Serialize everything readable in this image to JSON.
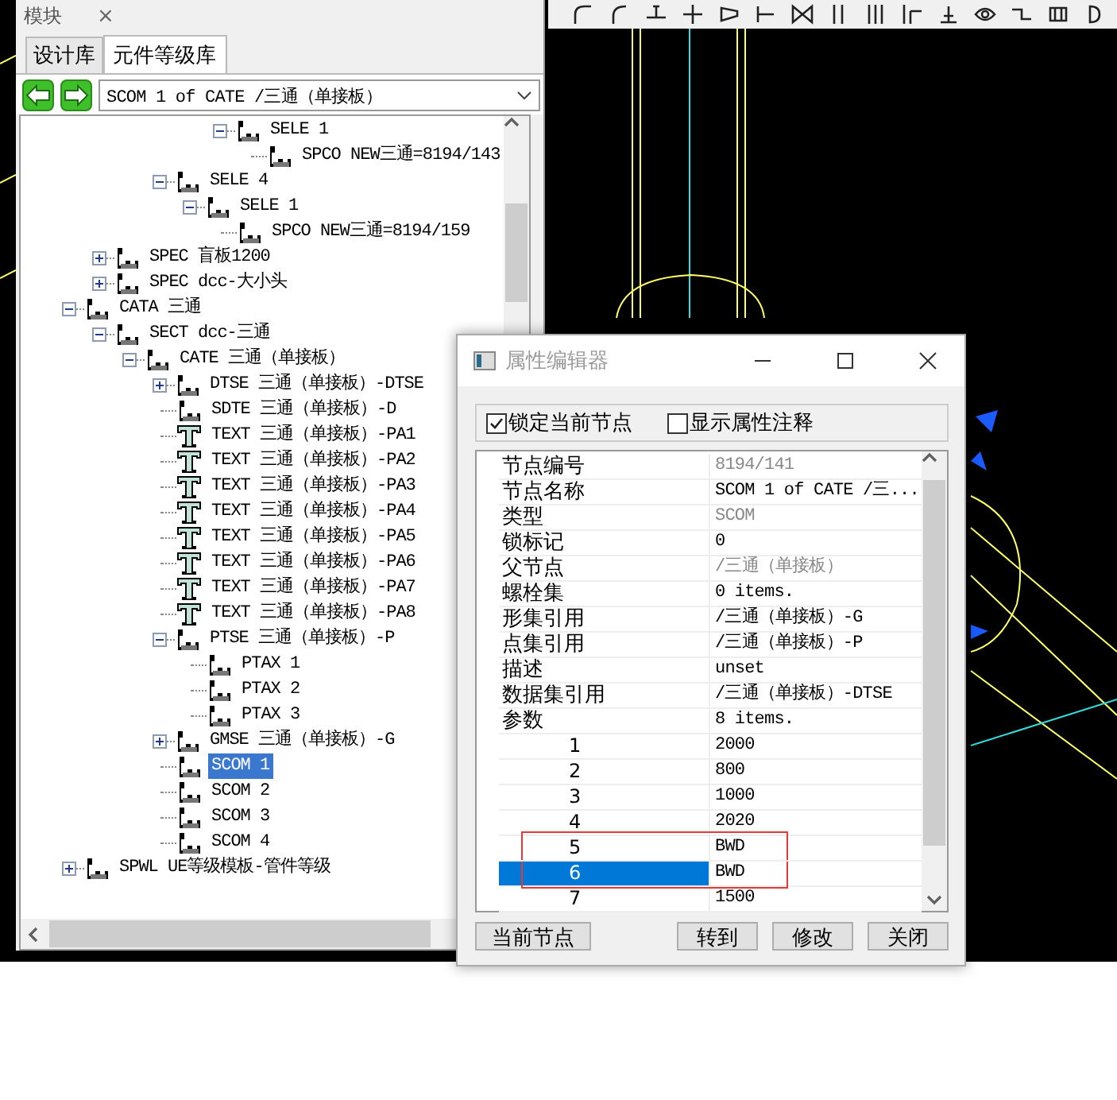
{
  "left_panel": {
    "title": "模块",
    "close": "×",
    "tabs": [
      {
        "label": "设计库",
        "selected": false
      },
      {
        "label": "元件等级库",
        "selected": true
      }
    ],
    "address": "SCOM 1 of CATE /三通（单接板）",
    "tree": [
      {
        "children": [
          {
            "children": [
              {
                "children": [
                  {
                    "children": [
                      {
                        "children": [
                          {
                            "label": "SELE 1",
                            "kind": "component",
                            "expanded": true,
                            "selected": false,
                            "children": [
                              {
                                "label": "SPCO NEW三通=8194/143",
                                "kind": "component",
                                "selected": false
                              }
                            ]
                          }
                        ]
                      }
                    ]
                  },
                  {
                    "label": "SELE 4",
                    "kind": "component",
                    "expanded": true,
                    "selected": false,
                    "children": [
                      {
                        "label": "SELE 1",
                        "kind": "component",
                        "expanded": true,
                        "selected": false,
                        "children": [
                          {
                            "label": "SPCO NEW三通=8194/159",
                            "kind": "component",
                            "selected": false
                          }
                        ]
                      }
                    ]
                  }
                ]
              }
            ]
          },
          {
            "label": "SPEC 盲板1200",
            "kind": "component",
            "expanded": false,
            "selected": false
          },
          {
            "label": "SPEC dcc-大小头",
            "kind": "component",
            "expanded": false,
            "selected": false
          }
        ]
      },
      {
        "label": "CATA 三通",
        "kind": "component",
        "expanded": true,
        "selected": false,
        "children": [
          {
            "label": "SECT dcc-三通",
            "kind": "component",
            "expanded": true,
            "selected": false,
            "children": [
              {
                "label": "CATE 三通（单接板）",
                "kind": "component",
                "expanded": true,
                "selected": false,
                "children": [
                  {
                    "label": "DTSE 三通（单接板）-DTSE",
                    "kind": "component",
                    "expanded": false,
                    "selected": false
                  },
                  {
                    "label": "SDTE 三通（单接板）-D",
                    "kind": "component",
                    "selected": false
                  },
                  {
                    "label": "TEXT 三通（单接板）-PA1",
                    "kind": "text",
                    "selected": false
                  },
                  {
                    "label": "TEXT 三通（单接板）-PA2",
                    "kind": "text",
                    "selected": false
                  },
                  {
                    "label": "TEXT 三通（单接板）-PA3",
                    "kind": "text",
                    "selected": false
                  },
                  {
                    "label": "TEXT 三通（单接板）-PA4",
                    "kind": "text",
                    "selected": false
                  },
                  {
                    "label": "TEXT 三通（单接板）-PA5",
                    "kind": "text",
                    "selected": false
                  },
                  {
                    "label": "TEXT 三通（单接板）-PA6",
                    "kind": "text",
                    "selected": false
                  },
                  {
                    "label": "TEXT 三通（单接板）-PA7",
                    "kind": "text",
                    "selected": false
                  },
                  {
                    "label": "TEXT 三通（单接板）-PA8",
                    "kind": "text",
                    "selected": false
                  },
                  {
                    "label": "PTSE 三通（单接板）-P",
                    "kind": "component",
                    "expanded": true,
                    "selected": false,
                    "children": [
                      {
                        "label": "PTAX 1",
                        "kind": "component",
                        "selected": false
                      },
                      {
                        "label": "PTAX 2",
                        "kind": "component",
                        "selected": false
                      },
                      {
                        "label": "PTAX 3",
                        "kind": "component",
                        "selected": false
                      }
                    ]
                  },
                  {
                    "label": "GMSE 三通（单接板）-G",
                    "kind": "component",
                    "expanded": false,
                    "selected": false
                  },
                  {
                    "label": "SCOM 1",
                    "kind": "component",
                    "selected": true
                  },
                  {
                    "label": "SCOM 2",
                    "kind": "component",
                    "selected": false
                  },
                  {
                    "label": "SCOM 3",
                    "kind": "component",
                    "selected": false
                  },
                  {
                    "label": "SCOM 4",
                    "kind": "component",
                    "selected": false
                  }
                ]
              }
            ]
          }
        ]
      },
      {
        "label": "SPWL UE等级模板-管件等级",
        "kind": "component",
        "expanded": false,
        "selected": false
      }
    ]
  },
  "dialog": {
    "title": "属性编辑器",
    "options": [
      {
        "label": "锁定当前节点",
        "checked": true
      },
      {
        "label": "显示属性注释",
        "checked": false
      }
    ],
    "properties": [
      {
        "name": "节点编号",
        "value": "8194/141",
        "dimmed": true
      },
      {
        "name": "节点名称",
        "value": "SCOM 1 of CATE /三...",
        "dimmed": false
      },
      {
        "name": "类型",
        "value": "SCOM",
        "dimmed": true
      },
      {
        "name": "锁标记",
        "value": "0",
        "dimmed": false
      },
      {
        "name": "父节点",
        "value": "/三通（单接板）",
        "dimmed": true
      },
      {
        "name": "螺栓集",
        "value": "0 items.",
        "dimmed": false
      },
      {
        "name": "形集引用",
        "value": "/三通（单接板）-G",
        "dimmed": false
      },
      {
        "name": "点集引用",
        "value": "/三通（单接板）-P",
        "dimmed": false
      },
      {
        "name": "描述",
        "value": "unset",
        "dimmed": false
      },
      {
        "name": "数据集引用",
        "value": "/三通（单接板）-DTSE",
        "dimmed": false
      },
      {
        "name": "参数",
        "value": "8 items.",
        "dimmed": false
      }
    ],
    "parameters": [
      {
        "index": "1",
        "value": "2000",
        "selected": false,
        "marked": false
      },
      {
        "index": "2",
        "value": "800",
        "selected": false,
        "marked": false
      },
      {
        "index": "3",
        "value": "1000",
        "selected": false,
        "marked": false
      },
      {
        "index": "4",
        "value": "2020",
        "selected": false,
        "marked": false
      },
      {
        "index": "5",
        "value": "BWD",
        "selected": false,
        "marked": true
      },
      {
        "index": "6",
        "value": "BWD",
        "selected": true,
        "marked": true
      },
      {
        "index": "7",
        "value": "1500",
        "selected": false,
        "marked": false
      }
    ],
    "buttons": [
      "当前节点",
      "转到",
      "修改",
      "关闭"
    ]
  }
}
